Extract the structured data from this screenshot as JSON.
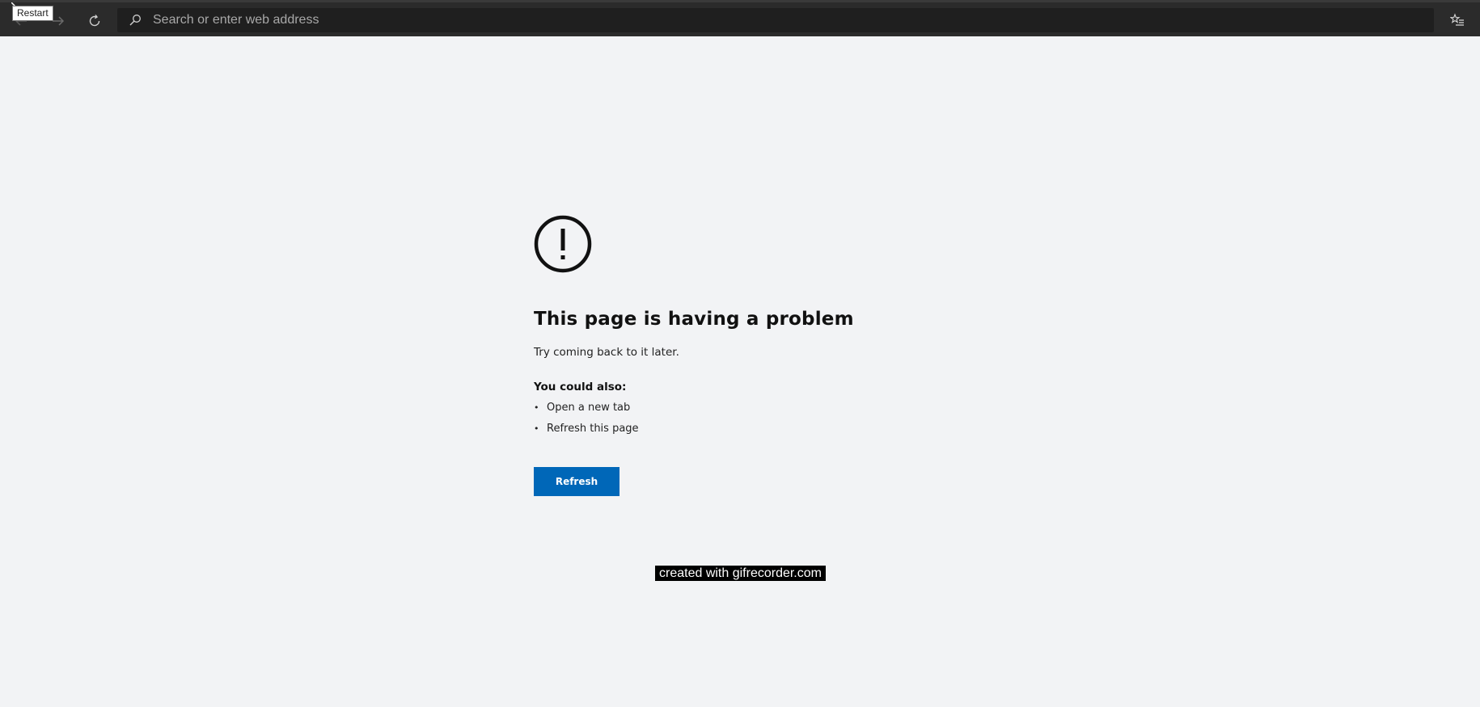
{
  "toolbar": {
    "back_icon": "back-arrow-icon",
    "forward_icon": "forward-arrow-icon",
    "reload_icon": "refresh-icon",
    "search_placeholder": "Search or enter web address",
    "favorites_icon": "favorites-list-icon",
    "tooltip": "Restart"
  },
  "error_page": {
    "icon": "exclamation-circle-icon",
    "title": "This page is having a problem",
    "subtitle": "Try coming back to it later.",
    "also_heading": "You could also:",
    "suggestions": [
      "Open a new tab",
      "Refresh this page"
    ],
    "refresh_label": "Refresh",
    "accent_color": "#0067b8"
  },
  "watermark": "created with gifrecorder.com"
}
